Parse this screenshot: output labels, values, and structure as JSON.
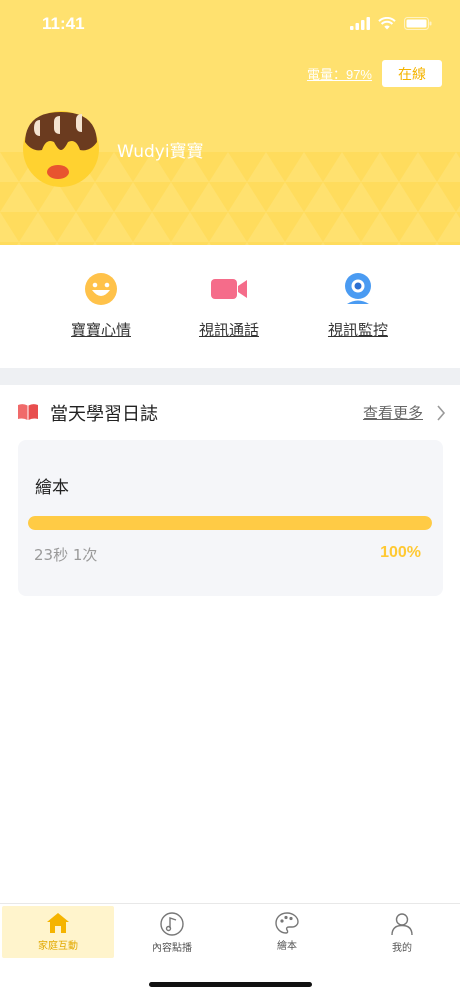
{
  "status_bar": {
    "time": "11:41"
  },
  "header": {
    "battery_label": "電量：97%",
    "online_label": "在線",
    "baby_name": "Wudyi寶寶",
    "background_color": "#FFE16F"
  },
  "actions": [
    {
      "label": "寶寶心情",
      "icon": "smiley-face-icon"
    },
    {
      "label": "視訊通話",
      "icon": "video-camera-icon"
    },
    {
      "label": "視訊監控",
      "icon": "webcam-icon"
    }
  ],
  "learning_log": {
    "title": "當天學習日誌",
    "more_label": "查看更多",
    "icon": "open-book-icon",
    "card": {
      "title": "繪本",
      "meta": "23秒 1次",
      "percent_label": "100%",
      "progress": 1.0,
      "progress_color": "#FFCB45"
    }
  },
  "tabbar": {
    "tabs": [
      {
        "label": "家庭互動",
        "icon": "home-icon",
        "active": true
      },
      {
        "label": "內容點播",
        "icon": "music-note-icon",
        "active": false
      },
      {
        "label": "繪本",
        "icon": "palette-icon",
        "active": false
      },
      {
        "label": "我的",
        "icon": "person-icon",
        "active": false
      }
    ],
    "active_color": "#F5B400"
  }
}
